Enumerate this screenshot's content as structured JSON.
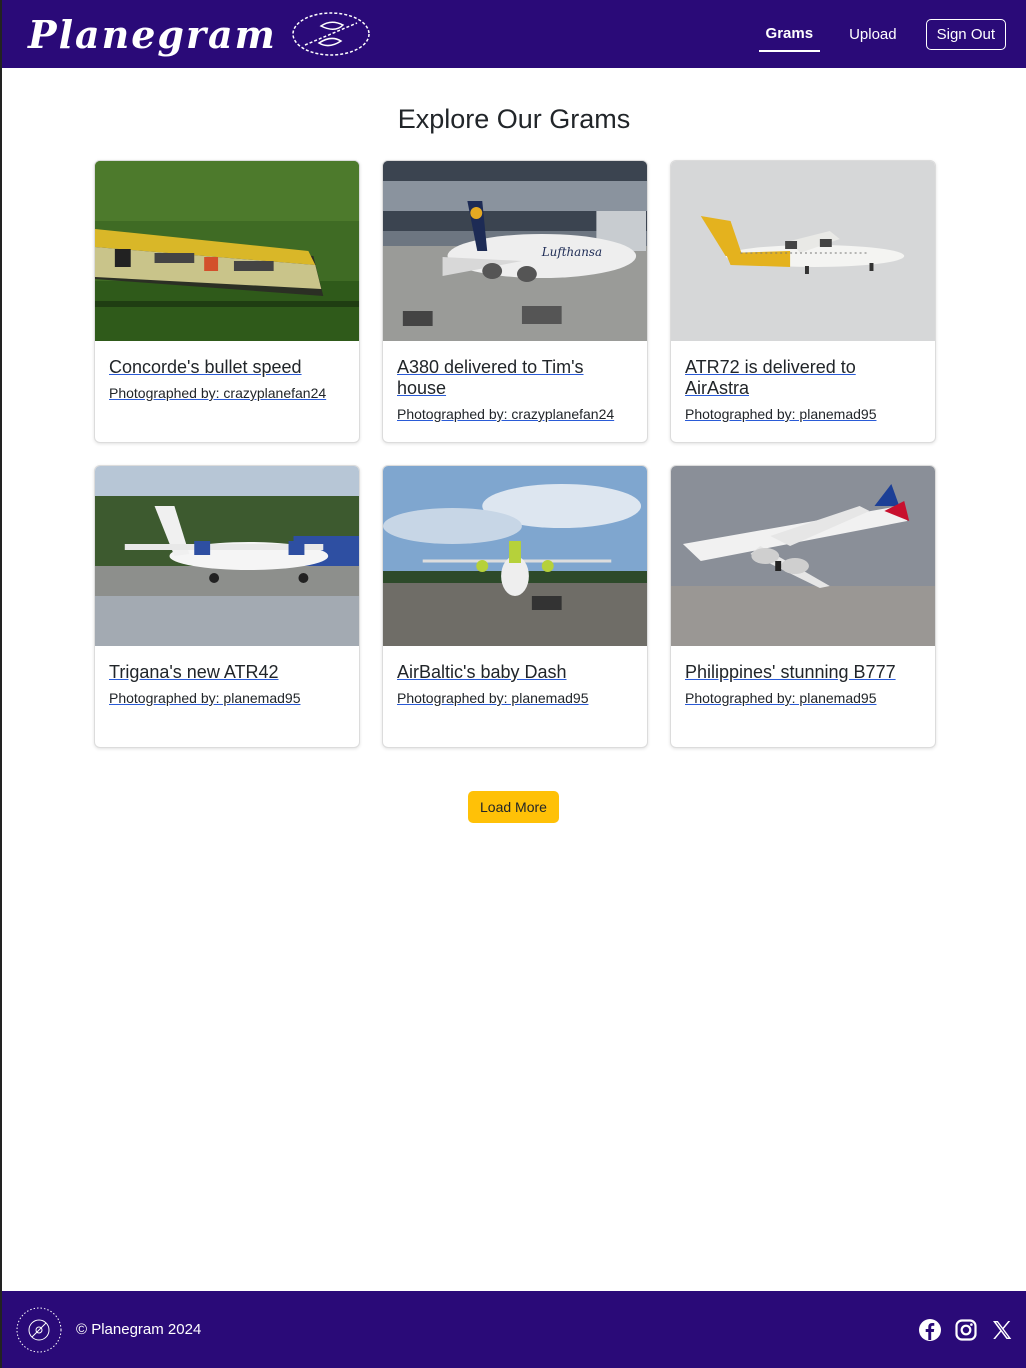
{
  "brand": {
    "name": "Planegram"
  },
  "nav": {
    "links": [
      {
        "label": "Grams",
        "active": true
      },
      {
        "label": "Upload",
        "active": false
      }
    ],
    "signout_label": "Sign Out"
  },
  "main": {
    "title": "Explore Our Grams",
    "cards": [
      {
        "title": "Concorde's bullet speed",
        "photographer": "Photographed by: crazyplanefan24"
      },
      {
        "title": "A380 delivered to Tim's house",
        "photographer": "Photographed by: crazyplanefan24"
      },
      {
        "title": "ATR72 is delivered to AirAstra",
        "photographer": "Photographed by: planemad95"
      },
      {
        "title": "Trigana's new ATR42",
        "photographer": "Photographed by: planemad95"
      },
      {
        "title": "AirBaltic's baby Dash",
        "photographer": "Photographed by: planemad95"
      },
      {
        "title": "Philippines' stunning B777",
        "photographer": "Photographed by: planemad95"
      }
    ],
    "load_more_label": "Load More"
  },
  "footer": {
    "copyright": "© Planegram 2024",
    "socials": [
      "facebook-icon",
      "instagram-icon",
      "x-icon"
    ]
  },
  "colors": {
    "brand_purple": "#2a0a78",
    "button_yellow": "#ffc107"
  }
}
